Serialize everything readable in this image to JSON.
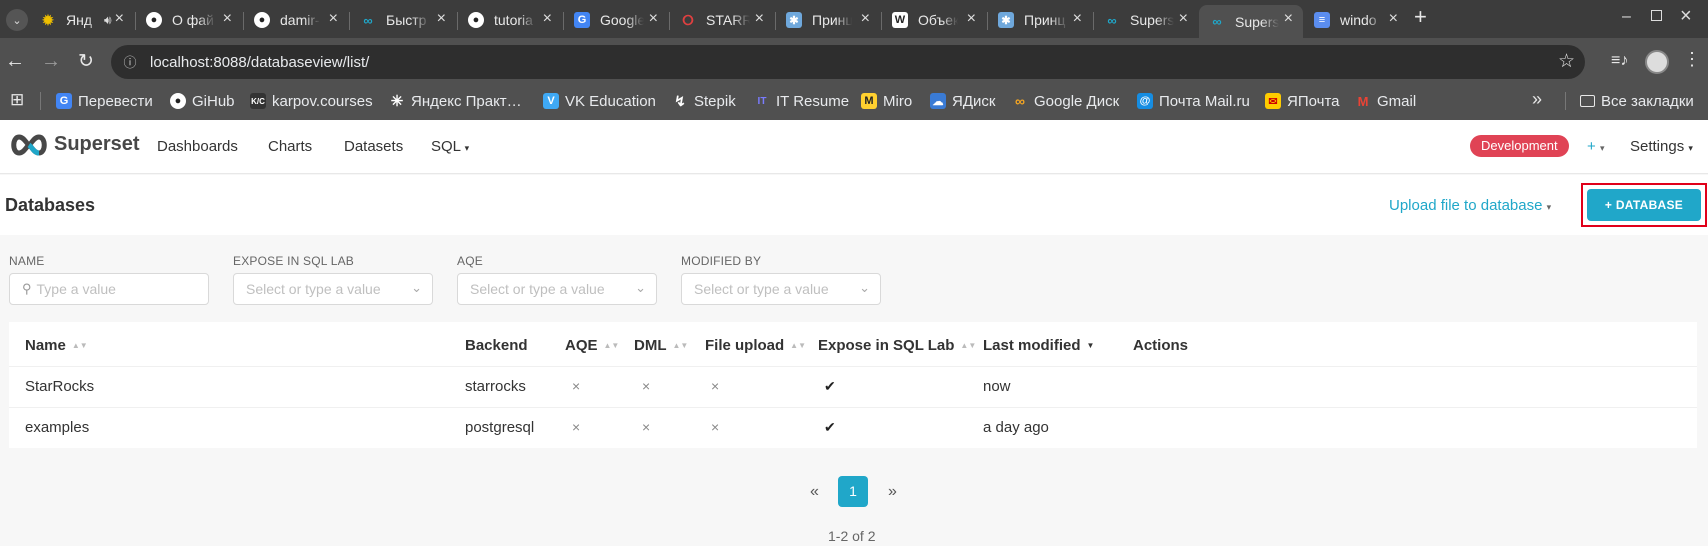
{
  "browser": {
    "tabs": [
      {
        "title": "Янд",
        "icon": "sun-icon",
        "color": "#f0c000"
      },
      {
        "title": "О фай",
        "icon": "github-icon",
        "color": "#ffffff"
      },
      {
        "title": "damir-",
        "icon": "github-icon",
        "color": "#ffffff"
      },
      {
        "title": "Быстр",
        "icon": "superset-logo-icon",
        "color": "#20a7c9"
      },
      {
        "title": "tutoria",
        "icon": "github-icon",
        "color": "#ffffff"
      },
      {
        "title": "Google",
        "icon": "google-translate-icon",
        "color": "#4285f4"
      },
      {
        "title": "STARR",
        "icon": "starrocks-icon",
        "color": "#e04040"
      },
      {
        "title": "Принц",
        "icon": "web-icon",
        "color": "#6fa8dc"
      },
      {
        "title": "Объек",
        "icon": "wikipedia-icon",
        "color": "#ffffff"
      },
      {
        "title": "Принц",
        "icon": "web-icon",
        "color": "#6fa8dc"
      },
      {
        "title": "Supers",
        "icon": "superset-logo-icon",
        "color": "#20a7c9"
      },
      {
        "title": "Supers",
        "icon": "superset-logo-icon",
        "color": "#20a7c9"
      },
      {
        "title": "windo",
        "icon": "docs-icon",
        "color": "#5b8def"
      }
    ],
    "active_tab_index": 11,
    "new_tab": "+",
    "url": "localhost:8088/databaseview/list/",
    "bookmarks": [
      {
        "label": "Перевести",
        "icon": "google-translate-icon",
        "color": "#4285f4"
      },
      {
        "label": "GiHub",
        "icon": "github-icon",
        "color": "#ffffff"
      },
      {
        "label": "karpov.courses",
        "icon": "karpov-icon",
        "color": "#333333"
      },
      {
        "label": "Яндекс Практ…",
        "icon": "asterisk-icon",
        "color": "#ffffff"
      },
      {
        "label": "VK Education",
        "icon": "vk-education-icon",
        "color": "#3fa9f5"
      },
      {
        "label": "Stepik",
        "icon": "stepik-icon",
        "color": "#ffffff"
      },
      {
        "label": "IT Resume",
        "icon": "it-resume-icon",
        "color": "#7a7cff"
      },
      {
        "label": "Miro",
        "icon": "miro-icon",
        "color": "#ffd02f"
      },
      {
        "label": "ЯДиск",
        "icon": "yadisk-icon",
        "color": "#3a7bd5"
      },
      {
        "label": "Google Диск",
        "icon": "google-drive-icon",
        "color": "#f5a623"
      },
      {
        "label": "Почта Mail.ru",
        "icon": "mailru-icon",
        "color": "#168de2"
      },
      {
        "label": "ЯПочта",
        "icon": "yandex-mail-icon",
        "color": "#ffcc00"
      },
      {
        "label": "Gmail",
        "icon": "gmail-icon",
        "color": "#ea4335"
      }
    ],
    "all_bookmarks": "Все закладки"
  },
  "app": {
    "brand": "Superset",
    "nav": [
      "Dashboards",
      "Charts",
      "Datasets",
      "SQL"
    ],
    "env_badge": "Development",
    "env_badge_color": "#e04355",
    "plus_menu": "+",
    "settings": "Settings",
    "accent": "#20a7c9"
  },
  "page": {
    "title": "Databases",
    "upload_link": "Upload file to database",
    "add_button": "+ DATABASE"
  },
  "filters": [
    {
      "label": "NAME",
      "placeholder": "Type a value"
    },
    {
      "label": "EXPOSE IN SQL LAB",
      "placeholder": "Select or type a value"
    },
    {
      "label": "AQE",
      "placeholder": "Select or type a value"
    },
    {
      "label": "MODIFIED BY",
      "placeholder": "Select or type a value"
    }
  ],
  "table": {
    "columns": [
      "Name",
      "Backend",
      "AQE",
      "DML",
      "File upload",
      "Expose in SQL Lab",
      "Last modified",
      "Actions"
    ],
    "rows": [
      {
        "name": "StarRocks",
        "backend": "starrocks",
        "aqe": "×",
        "dml": "×",
        "file_upload": "×",
        "expose": "✔",
        "modified": "now"
      },
      {
        "name": "examples",
        "backend": "postgresql",
        "aqe": "×",
        "dml": "×",
        "file_upload": "×",
        "expose": "✔",
        "modified": "a day ago"
      }
    ]
  },
  "pagination": {
    "prev": "«",
    "current": "1",
    "next": "»",
    "summary": "1-2 of 2"
  }
}
